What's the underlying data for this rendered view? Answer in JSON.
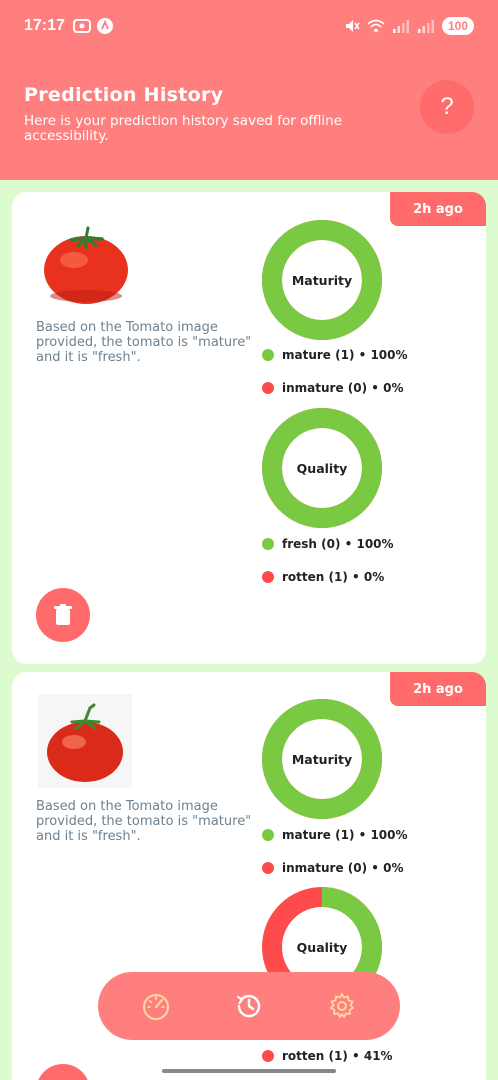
{
  "status_bar": {
    "time": "17:17",
    "battery": "100"
  },
  "header": {
    "title": "Prediction History",
    "subtitle": "Here is your prediction history saved for offline accessibility.",
    "help_label": "?"
  },
  "cards": [
    {
      "time_ago": "2h ago",
      "description": "Based on the Tomato image provided, the tomato is \"mature\" and it is \"fresh\".",
      "maturity": {
        "label": "Maturity",
        "mature_fraction": 1.0,
        "legend": [
          {
            "text": "mature (1) • 100%",
            "color": "#7ac943"
          },
          {
            "text": "inmature (0) • 0%",
            "color": "#ff4b4b"
          }
        ]
      },
      "quality": {
        "label": "Quality",
        "fresh_fraction": 1.0,
        "legend": [
          {
            "text": "fresh (0) • 100%",
            "color": "#7ac943"
          },
          {
            "text": "rotten (1) • 0%",
            "color": "#ff4b4b"
          }
        ]
      }
    },
    {
      "time_ago": "2h ago",
      "description": "Based on the Tomato image provided, the tomato is \"mature\" and it is \"fresh\".",
      "maturity": {
        "label": "Maturity",
        "mature_fraction": 1.0,
        "legend": [
          {
            "text": "mature (1) • 100%",
            "color": "#7ac943"
          },
          {
            "text": "inmature (0) • 0%",
            "color": "#ff4b4b"
          }
        ]
      },
      "quality": {
        "label": "Quality",
        "fresh_fraction": 0.59,
        "legend": [
          {
            "text": "rotten (1) • 41%",
            "color": "#ff4b4b"
          }
        ]
      }
    }
  ],
  "bottom_nav": {
    "items": [
      "speedometer-icon",
      "history-icon",
      "settings-icon"
    ]
  },
  "colors": {
    "header": "#ff7f7f",
    "accent": "#ff6b6b",
    "green": "#7ac943",
    "red": "#ff4b4b",
    "background": "#dcfccf"
  }
}
